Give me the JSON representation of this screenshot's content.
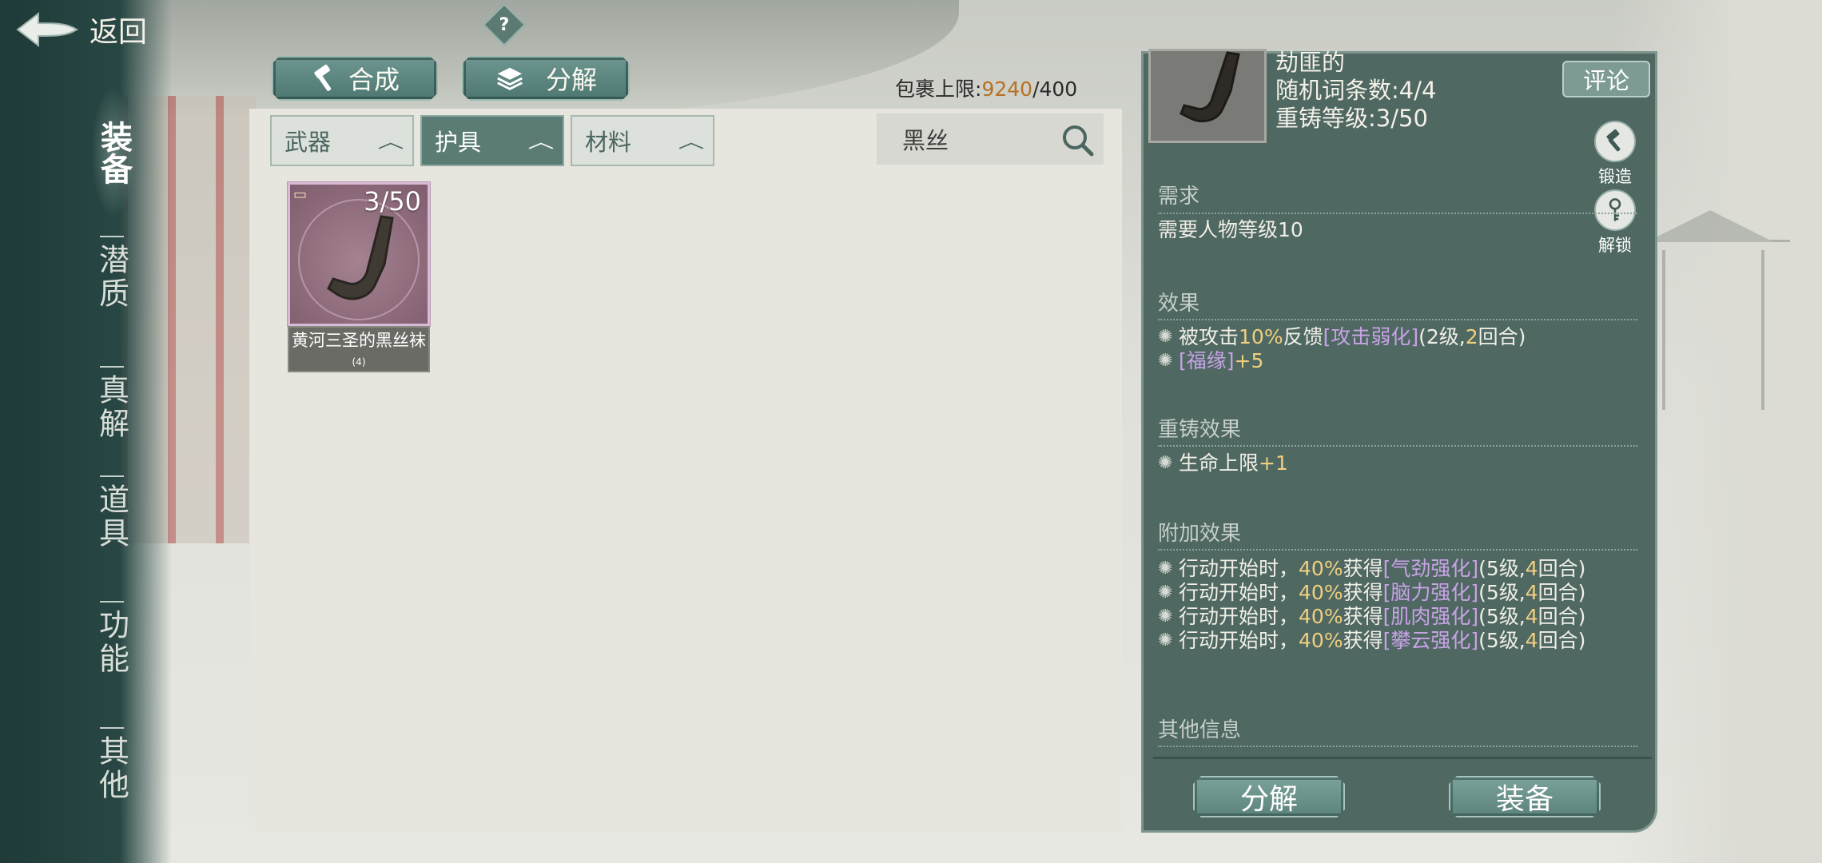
{
  "header": {
    "back_label": "返回",
    "help_symbol": "?"
  },
  "sidebar": {
    "active": "装备",
    "items": [
      "潜质",
      "真解",
      "道具",
      "功能",
      "其他"
    ]
  },
  "toolbar": {
    "synthesize_label": "合成",
    "decompose_label": "分解",
    "bag_limit_label": "包裹上限:",
    "bag_current": "9240",
    "bag_max": "/400"
  },
  "tabs": [
    {
      "label": "武器",
      "active": false
    },
    {
      "label": "护具",
      "active": true
    },
    {
      "label": "材料",
      "active": false
    }
  ],
  "search": {
    "value": "黑丝"
  },
  "items": [
    {
      "count": "3/50",
      "name": "黄河三圣的黑丝袜",
      "suffix": "(4)"
    }
  ],
  "detail": {
    "prefix": "劫匪的",
    "affix_count": "随机词条数:4/4",
    "reforge_level": "重铸等级:3/50",
    "comment_label": "评论",
    "forge_label": "锻造",
    "unlock_label": "解锁",
    "requirement_title": "需求",
    "requirement_text": "需要人物等级10",
    "effect_title": "效果",
    "effects": [
      {
        "parts": [
          {
            "t": "被攻击",
            "c": ""
          },
          {
            "t": "10%",
            "c": "y"
          },
          {
            "t": "反馈",
            "c": ""
          },
          {
            "t": "[攻击弱化]",
            "c": "p"
          },
          {
            "t": "(2级,",
            "c": ""
          },
          {
            "t": "2",
            "c": "y"
          },
          {
            "t": "回合)",
            "c": ""
          }
        ]
      },
      {
        "parts": [
          {
            "t": "[福缘]",
            "c": "p"
          },
          {
            "t": "+5",
            "c": "y"
          }
        ]
      }
    ],
    "reforge_title": "重铸效果",
    "reforge_effects": [
      {
        "parts": [
          {
            "t": "生命上限",
            "c": ""
          },
          {
            "t": "+1",
            "c": "y"
          }
        ]
      }
    ],
    "extra_title": "附加效果",
    "extra_effects": [
      {
        "parts": [
          {
            "t": "行动开始时，",
            "c": ""
          },
          {
            "t": "40%",
            "c": "y"
          },
          {
            "t": "获得",
            "c": ""
          },
          {
            "t": "[气劲强化]",
            "c": "p"
          },
          {
            "t": "(5级,",
            "c": ""
          },
          {
            "t": "4",
            "c": "y"
          },
          {
            "t": "回合)",
            "c": ""
          }
        ]
      },
      {
        "parts": [
          {
            "t": "行动开始时，",
            "c": ""
          },
          {
            "t": "40%",
            "c": "y"
          },
          {
            "t": "获得",
            "c": ""
          },
          {
            "t": "[脑力强化]",
            "c": "p"
          },
          {
            "t": "(5级,",
            "c": ""
          },
          {
            "t": "4",
            "c": "y"
          },
          {
            "t": "回合)",
            "c": ""
          }
        ]
      },
      {
        "parts": [
          {
            "t": "行动开始时，",
            "c": ""
          },
          {
            "t": "40%",
            "c": "y"
          },
          {
            "t": "获得",
            "c": ""
          },
          {
            "t": "[肌肉强化]",
            "c": "p"
          },
          {
            "t": "(5级,",
            "c": ""
          },
          {
            "t": "4",
            "c": "y"
          },
          {
            "t": "回合)",
            "c": ""
          }
        ]
      },
      {
        "parts": [
          {
            "t": "行动开始时，",
            "c": ""
          },
          {
            "t": "40%",
            "c": "y"
          },
          {
            "t": "获得",
            "c": ""
          },
          {
            "t": "[攀云强化]",
            "c": "p"
          },
          {
            "t": "(5级,",
            "c": ""
          },
          {
            "t": "4",
            "c": "y"
          },
          {
            "t": "回合)",
            "c": ""
          }
        ]
      }
    ],
    "other_title": "其他信息",
    "decompose_label": "分解",
    "equip_label": "装备"
  },
  "icons": {
    "back": "back-arrow-icon",
    "synthesize": "hammer-icon",
    "decompose": "layers-icon",
    "search": "search-icon",
    "forge": "hammer-icon",
    "unlock": "key-icon",
    "bullet": "sparkle-icon"
  },
  "colors": {
    "accent": "#5a7c75",
    "highlight_number": "#f0cf7e",
    "highlight_status": "#c8a3e6",
    "bag_count": "#b67122"
  }
}
